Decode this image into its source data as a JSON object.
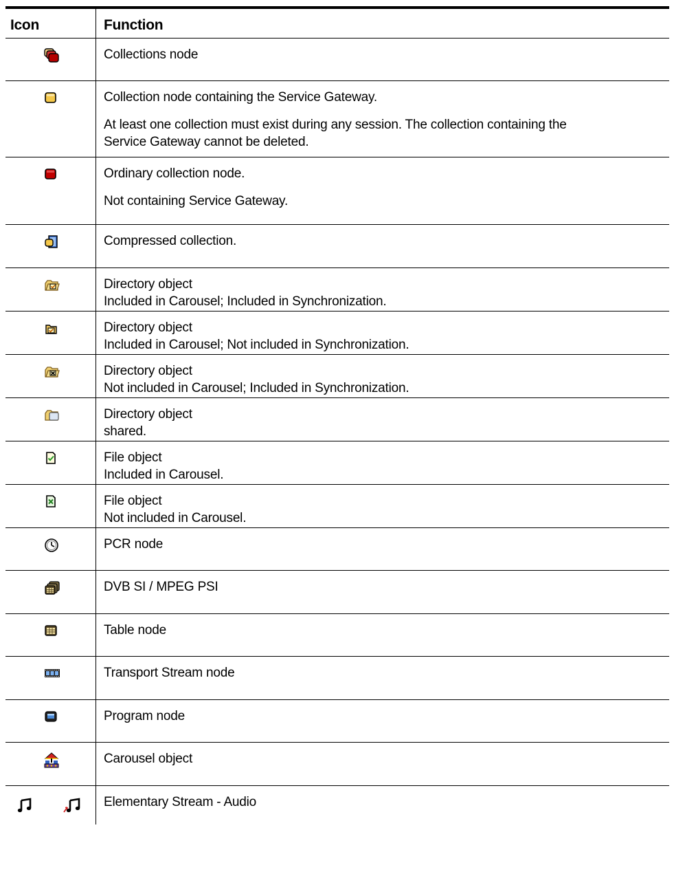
{
  "table": {
    "header": {
      "icon": "Icon",
      "function": "Function"
    },
    "rows": [
      {
        "icon": "collections-node-icon",
        "lines": [
          "Collections node"
        ]
      },
      {
        "icon": "service-gateway-collection-icon",
        "lines": [
          "Collection node containing the Service Gateway."
        ],
        "para2": [
          "At least one collection must exist during any session. The collection containing the",
          "Service Gateway cannot be deleted."
        ]
      },
      {
        "icon": "ordinary-collection-icon",
        "lines": [
          "Ordinary collection node."
        ],
        "para2": [
          "Not containing Service Gateway."
        ]
      },
      {
        "icon": "compressed-collection-icon",
        "lines": [
          "Compressed collection."
        ]
      },
      {
        "icon": "directory-carousel-sync-icon",
        "lines": [
          "Directory object",
          "Included in Carousel; Included in Synchronization."
        ]
      },
      {
        "icon": "directory-carousel-nosync-icon",
        "lines": [
          "Directory object",
          "Included in Carousel; Not included in Synchronization."
        ]
      },
      {
        "icon": "directory-nocarousel-sync-icon",
        "lines": [
          "Directory object",
          "Not included in Carousel; Included in Synchronization."
        ]
      },
      {
        "icon": "directory-shared-icon",
        "lines": [
          "Directory object",
          "shared."
        ]
      },
      {
        "icon": "file-included-icon",
        "lines": [
          "File object",
          "Included in Carousel."
        ]
      },
      {
        "icon": "file-excluded-icon",
        "lines": [
          "File object",
          "Not included in Carousel."
        ]
      },
      {
        "icon": "pcr-clock-icon",
        "lines": [
          "PCR node"
        ]
      },
      {
        "icon": "dvb-si-tables-icon",
        "lines": [
          "DVB SI / MPEG PSI"
        ]
      },
      {
        "icon": "table-node-icon",
        "lines": [
          "Table node"
        ]
      },
      {
        "icon": "transport-stream-film-icon",
        "lines": [
          "Transport Stream node"
        ]
      },
      {
        "icon": "program-monitor-icon",
        "lines": [
          "Program node"
        ]
      },
      {
        "icon": "carousel-object-icon",
        "lines": [
          "Carousel object"
        ]
      },
      {
        "icon": "audio-note-icon",
        "lines": [
          "Elementary Stream - Audio"
        ]
      }
    ]
  },
  "colors": {
    "red": "#c00000",
    "yellow": "#f5c84a",
    "blue": "#2050c0",
    "green": "#2a9a2a"
  }
}
